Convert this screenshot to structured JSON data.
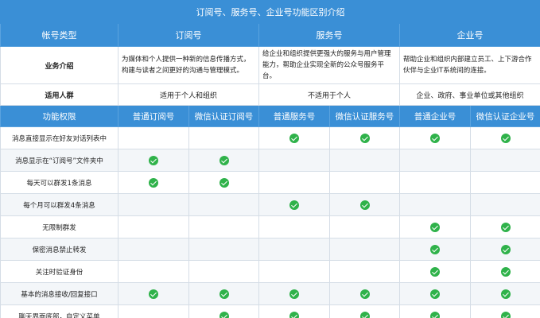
{
  "title": "订阅号、服务号、企业号功能区别介绍",
  "headers": {
    "account_type": "帐号类型",
    "subscription": "订阅号",
    "service": "服务号",
    "enterprise": "企业号"
  },
  "intro": {
    "label": "业务介绍",
    "subscription": "为媒体和个人提供一种新的信息传播方式，构建与读者之间更好的沟通与管理模式。",
    "service": "给企业和组织提供更强大的服务与用户管理能力，帮助企业实现全新的公众号服务平台。",
    "enterprise": "帮助企业和组织内部建立员工、上下游合作伙伴与企业IT系统间的连接。"
  },
  "audience": {
    "label": "适用人群",
    "subscription": "适用于个人和组织",
    "service": "不适用于个人",
    "enterprise": "企业、政府、事业单位或其他组织"
  },
  "sub_headers": {
    "function": "功能权限",
    "cols": [
      "普通订阅号",
      "微信认证订阅号",
      "普通服务号",
      "微信认证服务号",
      "普通企业号",
      "微信认证企业号"
    ]
  },
  "features": [
    {
      "name": "消息直接显示在好友对话列表中",
      "checks": [
        false,
        false,
        true,
        true,
        true,
        true
      ]
    },
    {
      "name": "消息显示在“订阅号”文件夹中",
      "checks": [
        true,
        true,
        false,
        false,
        false,
        false
      ]
    },
    {
      "name": "每天可以群发1条消息",
      "checks": [
        true,
        true,
        false,
        false,
        false,
        false
      ]
    },
    {
      "name": "每个月可以群发4条消息",
      "checks": [
        false,
        false,
        true,
        true,
        false,
        false
      ]
    },
    {
      "name": "无限制群发",
      "checks": [
        false,
        false,
        false,
        false,
        true,
        true
      ]
    },
    {
      "name": "保密消息禁止转发",
      "checks": [
        false,
        false,
        false,
        false,
        true,
        true
      ]
    },
    {
      "name": "关注时验证身份",
      "checks": [
        false,
        false,
        false,
        false,
        true,
        true
      ]
    },
    {
      "name": "基本的消息接收/回复接口",
      "checks": [
        true,
        true,
        true,
        true,
        true,
        true
      ]
    },
    {
      "name": "聊天界面底部，自定义菜单",
      "checks": [
        false,
        true,
        true,
        true,
        true,
        true
      ]
    }
  ],
  "colors": {
    "header_blue": "#3a8fd6",
    "check_green": "#2fb24a",
    "border": "#d5dde6"
  },
  "icons": {
    "check": "check-circle-icon"
  }
}
